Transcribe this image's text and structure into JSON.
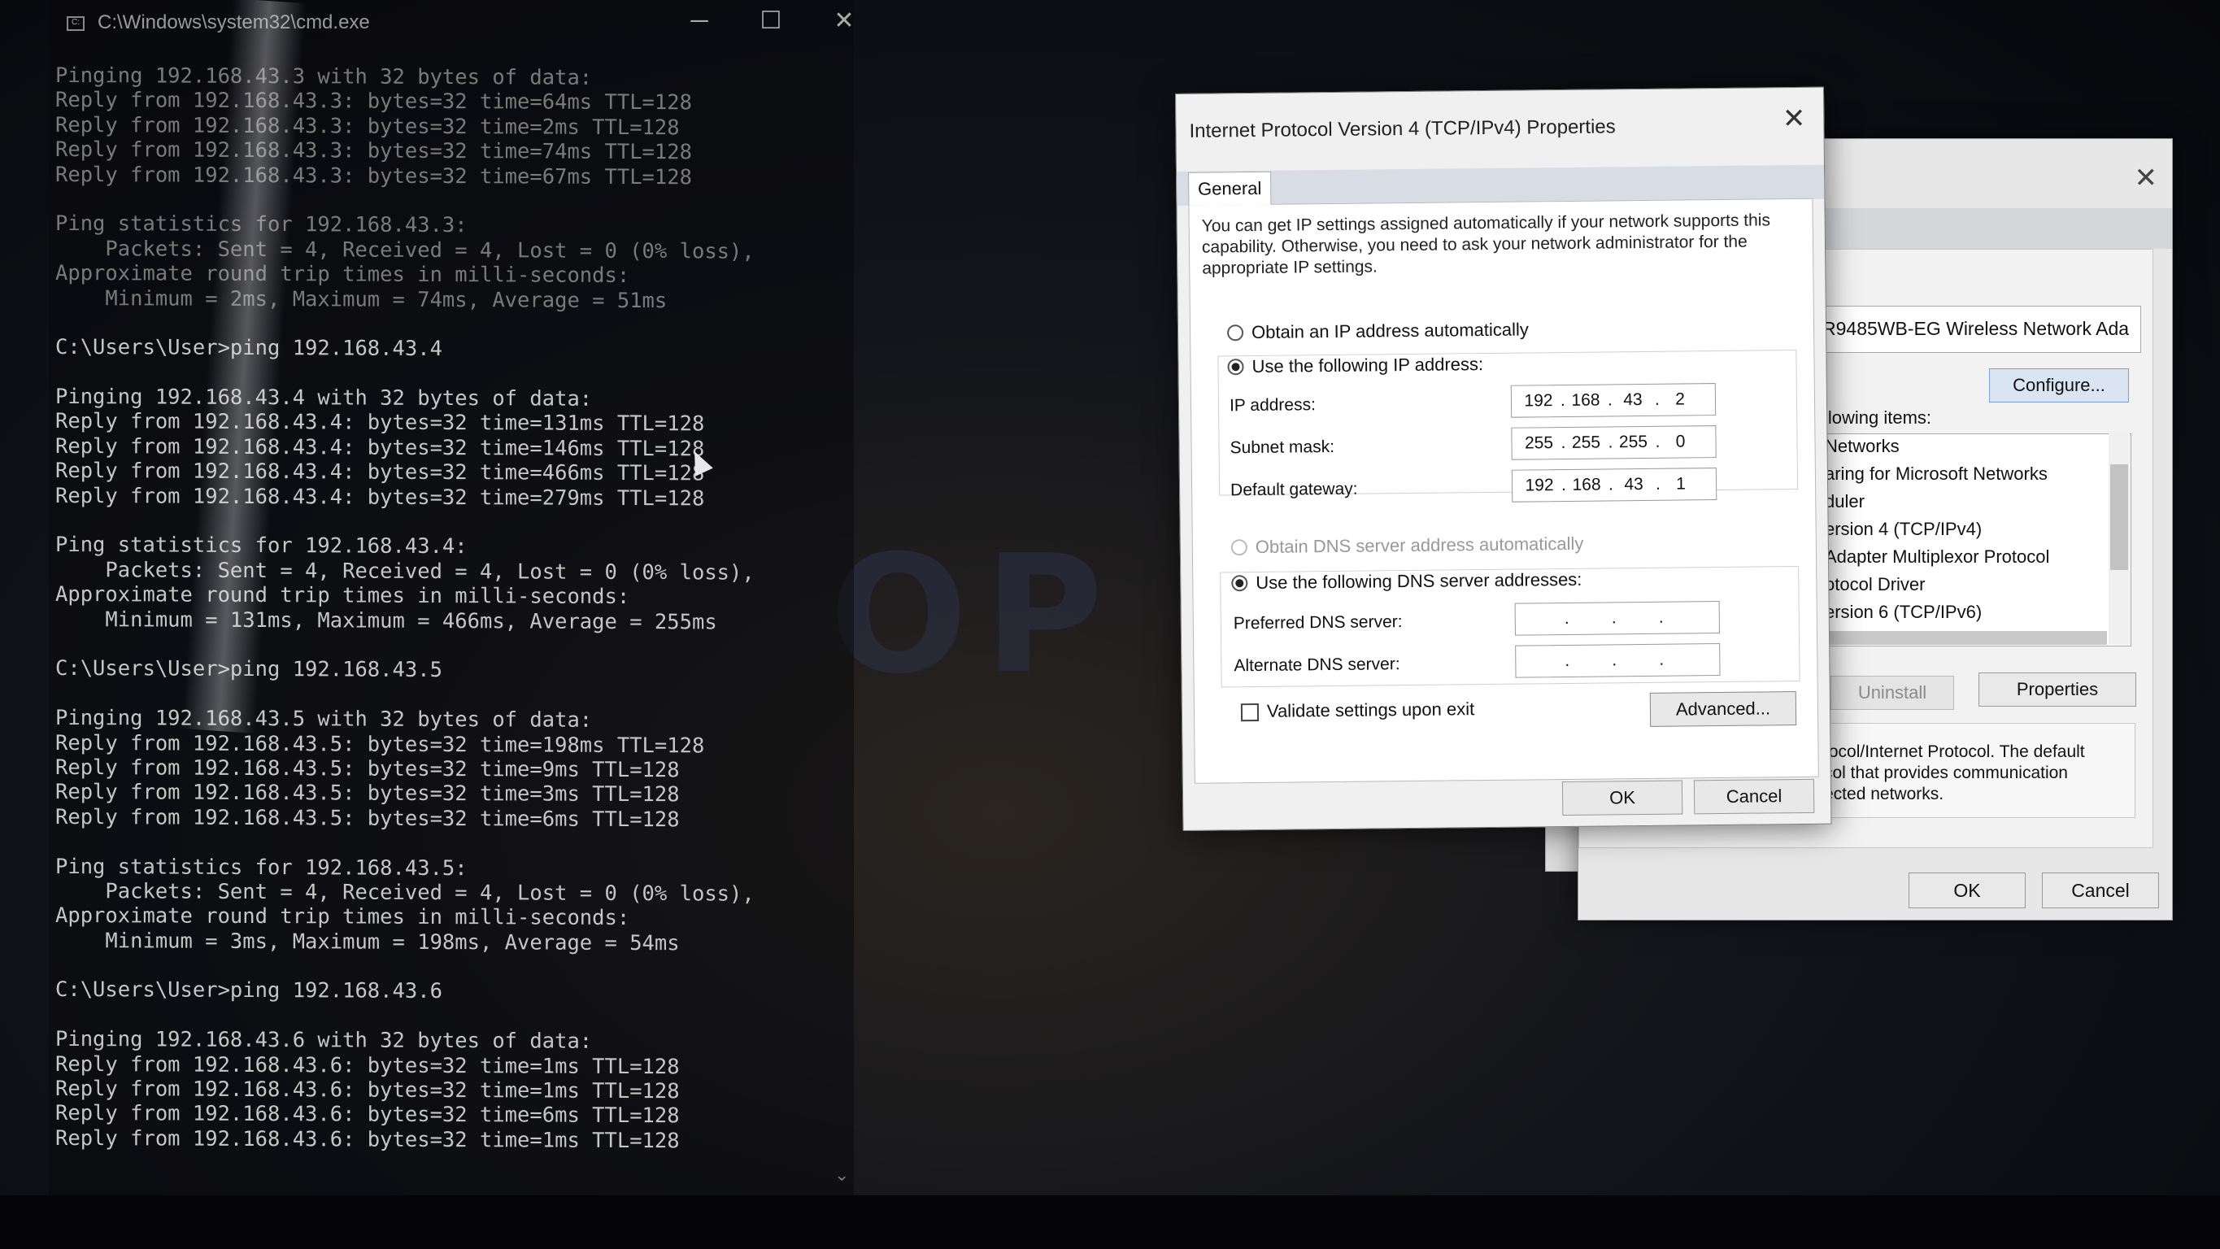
{
  "cmd": {
    "title": "C:\\Windows\\system32\\cmd.exe",
    "icon": "cmd-icon",
    "controls": {
      "minimize": "─",
      "maximize": "☐",
      "close": "✕"
    },
    "lines": [
      {
        "text": "Pinging 192.168.43.3 with 32 bytes of data:",
        "dim": true
      },
      {
        "text": "Reply from 192.168.43.3: bytes=32 time=64ms TTL=128",
        "dim": true
      },
      {
        "text": "Reply from 192.168.43.3: bytes=32 time=2ms TTL=128",
        "dim": true
      },
      {
        "text": "Reply from 192.168.43.3: bytes=32 time=74ms TTL=128",
        "dim": true
      },
      {
        "text": "Reply from 192.168.43.3: bytes=32 time=67ms TTL=128",
        "dim": true
      },
      {
        "text": "",
        "dim": false
      },
      {
        "text": "Ping statistics for 192.168.43.3:",
        "dim": true
      },
      {
        "text": "    Packets: Sent = 4, Received = 4, Lost = 0 (0% loss),",
        "dim": true
      },
      {
        "text": "Approximate round trip times in milli-seconds:",
        "dim": true
      },
      {
        "text": "    Minimum = 2ms, Maximum = 74ms, Average = 51ms",
        "dim": true
      },
      {
        "text": "",
        "dim": false
      },
      {
        "text": "C:\\Users\\User>ping 192.168.43.4",
        "dim": false
      },
      {
        "text": "",
        "dim": false
      },
      {
        "text": "Pinging 192.168.43.4 with 32 bytes of data:",
        "dim": false
      },
      {
        "text": "Reply from 192.168.43.4: bytes=32 time=131ms TTL=128",
        "dim": false
      },
      {
        "text": "Reply from 192.168.43.4: bytes=32 time=146ms TTL=128",
        "dim": false
      },
      {
        "text": "Reply from 192.168.43.4: bytes=32 time=466ms TTL=128",
        "dim": false
      },
      {
        "text": "Reply from 192.168.43.4: bytes=32 time=279ms TTL=128",
        "dim": false
      },
      {
        "text": "",
        "dim": false
      },
      {
        "text": "Ping statistics for 192.168.43.4:",
        "dim": false
      },
      {
        "text": "    Packets: Sent = 4, Received = 4, Lost = 0 (0% loss),",
        "dim": false
      },
      {
        "text": "Approximate round trip times in milli-seconds:",
        "dim": false
      },
      {
        "text": "    Minimum = 131ms, Maximum = 466ms, Average = 255ms",
        "dim": false
      },
      {
        "text": "",
        "dim": false
      },
      {
        "text": "C:\\Users\\User>ping 192.168.43.5",
        "dim": false
      },
      {
        "text": "",
        "dim": false
      },
      {
        "text": "Pinging 192.168.43.5 with 32 bytes of data:",
        "dim": false
      },
      {
        "text": "Reply from 192.168.43.5: bytes=32 time=198ms TTL=128",
        "dim": false
      },
      {
        "text": "Reply from 192.168.43.5: bytes=32 time=9ms TTL=128",
        "dim": false
      },
      {
        "text": "Reply from 192.168.43.5: bytes=32 time=3ms TTL=128",
        "dim": false
      },
      {
        "text": "Reply from 192.168.43.5: bytes=32 time=6ms TTL=128",
        "dim": false
      },
      {
        "text": "",
        "dim": false
      },
      {
        "text": "Ping statistics for 192.168.43.5:",
        "dim": false
      },
      {
        "text": "    Packets: Sent = 4, Received = 4, Lost = 0 (0% loss),",
        "dim": false
      },
      {
        "text": "Approximate round trip times in milli-seconds:",
        "dim": false
      },
      {
        "text": "    Minimum = 3ms, Maximum = 198ms, Average = 54ms",
        "dim": false
      },
      {
        "text": "",
        "dim": false
      },
      {
        "text": "C:\\Users\\User>ping 192.168.43.6",
        "dim": false
      },
      {
        "text": "",
        "dim": false
      },
      {
        "text": "Pinging 192.168.43.6 with 32 bytes of data:",
        "dim": false
      },
      {
        "text": "Reply from 192.168.43.6: bytes=32 time=1ms TTL=128",
        "dim": false
      },
      {
        "text": "Reply from 192.168.43.6: bytes=32 time=1ms TTL=128",
        "dim": false
      },
      {
        "text": "Reply from 192.168.43.6: bytes=32 time=6ms TTL=128",
        "dim": false
      },
      {
        "text": "Reply from 192.168.43.6: bytes=32 time=1ms TTL=128",
        "dim": false
      }
    ]
  },
  "background_word": "OP C",
  "ipv4_dialog": {
    "title": "Internet Protocol Version 4 (TCP/IPv4) Properties",
    "close": "✕",
    "tab": "General",
    "intro": "You can get IP settings assigned automatically if your network supports this capability. Otherwise, you need to ask your network administrator for the appropriate IP settings.",
    "obtain_ip_auto": "Obtain an IP address automatically",
    "use_following_ip": "Use the following IP address:",
    "ip_address_label": "IP address:",
    "ip_address": [
      "192",
      "168",
      "43",
      "2"
    ],
    "subnet_mask_label": "Subnet mask:",
    "subnet_mask": [
      "255",
      "255",
      "255",
      "0"
    ],
    "default_gateway_label": "Default gateway:",
    "default_gateway": [
      "192",
      "168",
      "43",
      "1"
    ],
    "obtain_dns_auto": "Obtain DNS server address automatically",
    "use_following_dns": "Use the following DNS server addresses:",
    "preferred_dns_label": "Preferred DNS server:",
    "preferred_dns": [
      "",
      "",
      "",
      ""
    ],
    "alternate_dns_label": "Alternate DNS server:",
    "alternate_dns": [
      "",
      "",
      "",
      ""
    ],
    "validate_label": "Validate settings upon exit",
    "advanced": "Advanced...",
    "ok": "OK",
    "cancel": "Cancel"
  },
  "adapter_dialog": {
    "close": "✕",
    "adapter_name": "R9485WB-EG Wireless Network Ada",
    "configure": "Configure...",
    "items_label": "llowing items:",
    "items": [
      "Networks",
      "aring for Microsoft Networks",
      "duler",
      "ersion 4 (TCP/IPv4)",
      "Adapter Multiplexor Protocol",
      "otocol Driver",
      "ersion 6 (TCP/IPv6)"
    ],
    "uninstall": "Uninstall",
    "properties": "Properties",
    "description": [
      "tocol/Internet Protocol. The default",
      "col that provides communication",
      "ected networks."
    ],
    "ok": "OK",
    "cancel": "Cancel"
  }
}
